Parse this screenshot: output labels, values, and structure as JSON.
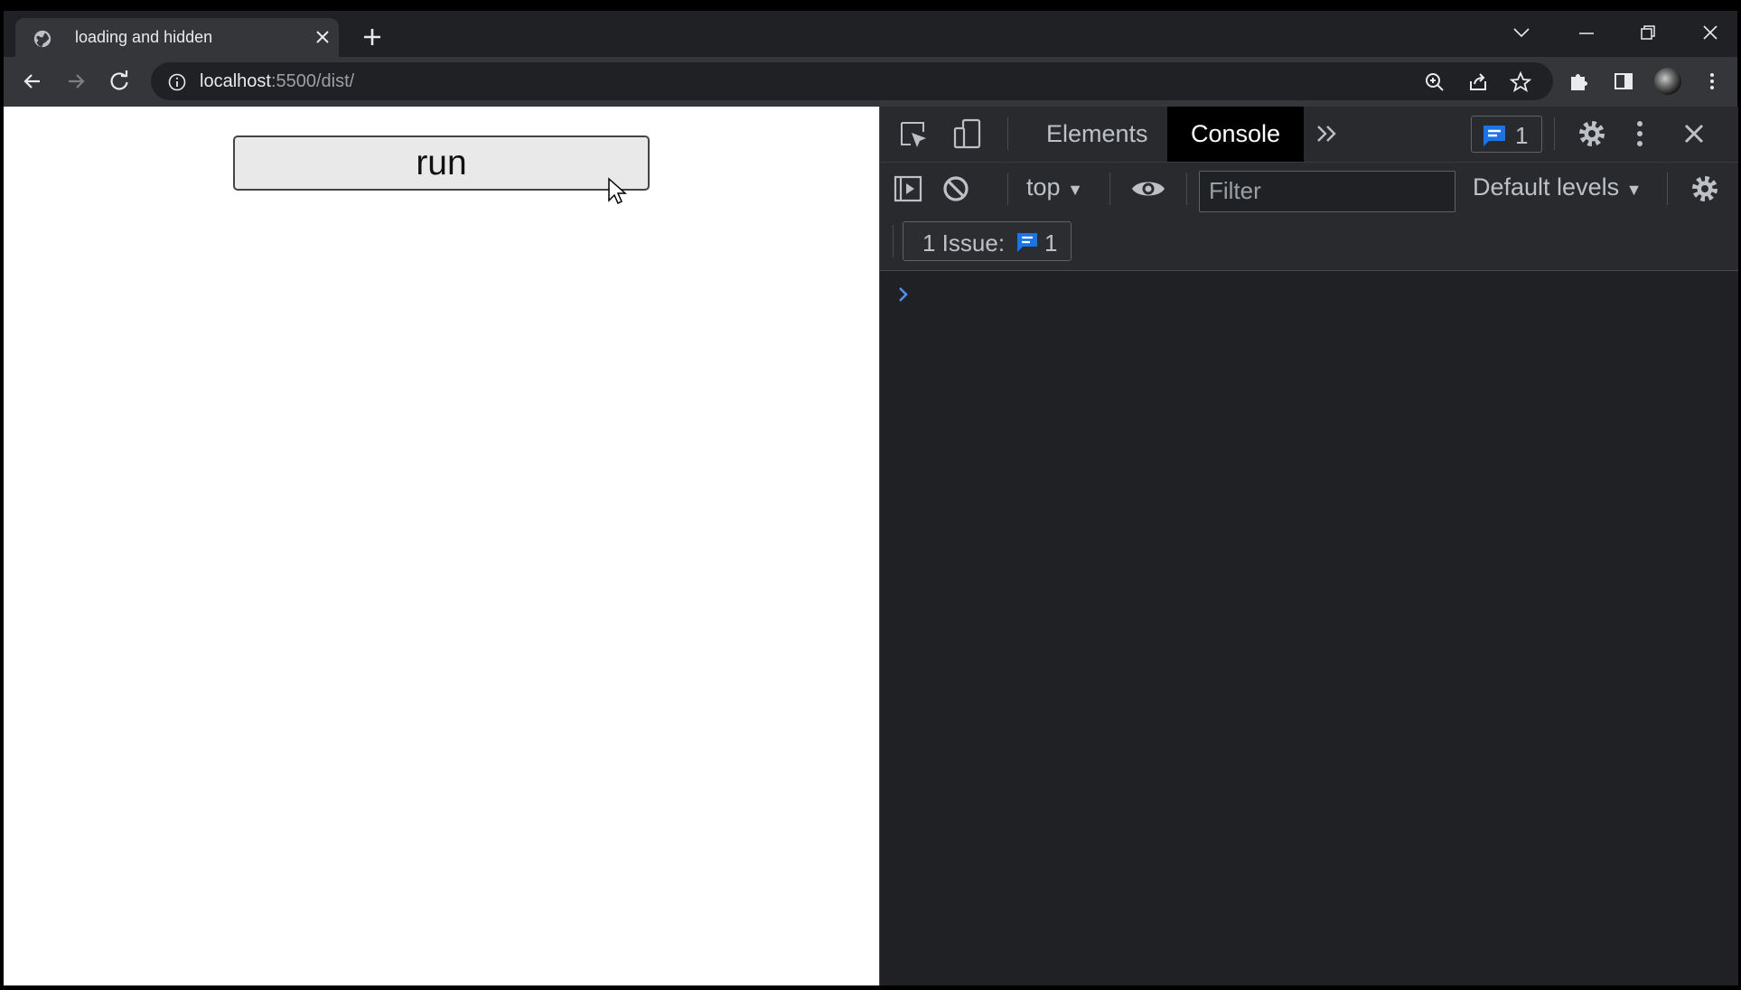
{
  "browser": {
    "tab": {
      "title": "loading and hidden"
    },
    "address": {
      "host": "localhost",
      "path": ":5500/dist/"
    }
  },
  "page": {
    "run_button_label": "run"
  },
  "devtools": {
    "tabs": [
      {
        "label": "Elements",
        "active": false
      },
      {
        "label": "Console",
        "active": true
      }
    ],
    "issues_count": "1",
    "context": "top",
    "filter_placeholder": "Filter",
    "levels": "Default levels",
    "issue_bar": {
      "label": "1 Issue:",
      "count": "1"
    }
  },
  "colors": {
    "accent_blue": "#1a73e8",
    "devtools_bg": "#202124",
    "chrome_toolbar": "#35363a"
  },
  "icons": [
    "globe-icon",
    "close-icon",
    "plus-icon",
    "chevron-down-icon",
    "minimize-icon",
    "restore-icon",
    "back-arrow-icon",
    "forward-arrow-icon",
    "reload-icon",
    "info-icon",
    "zoom-icon",
    "share-icon",
    "star-icon",
    "puzzle-icon",
    "side-panel-icon",
    "kebab-menu-icon",
    "inspect-icon",
    "device-icon",
    "double-chevron-icon",
    "message-icon",
    "gear-icon",
    "sidebar-toggle-icon",
    "block-icon",
    "eye-icon",
    "prompt-chevron-icon",
    "mouse-pointer-icon"
  ]
}
